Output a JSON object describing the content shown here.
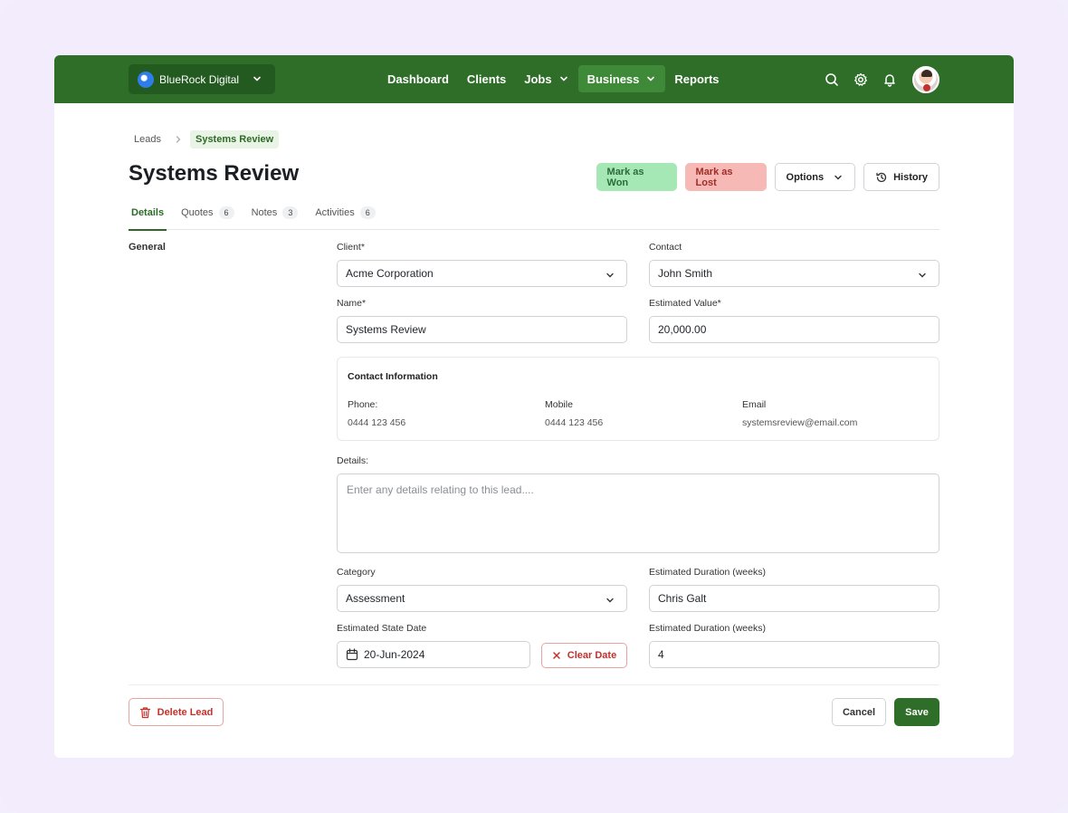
{
  "app": {
    "org_name": "BlueRock Digital",
    "nav": [
      {
        "label": "Dashboard"
      },
      {
        "label": "Clients"
      },
      {
        "label": "Jobs"
      },
      {
        "label": "Business"
      },
      {
        "label": "Reports"
      }
    ]
  },
  "breadcrumb": {
    "parent": "Leads",
    "current": "Systems Review"
  },
  "page": {
    "title": "Systems Review",
    "actions": {
      "won": "Mark as Won",
      "lost": "Mark as Lost",
      "options": "Options",
      "history": "History"
    }
  },
  "tabs": [
    {
      "label": "Details",
      "count": ""
    },
    {
      "label": "Quotes",
      "count": "6"
    },
    {
      "label": "Notes",
      "count": "3"
    },
    {
      "label": "Activities",
      "count": "6"
    }
  ],
  "form": {
    "section": "General",
    "client_label": "Client*",
    "client_value": "Acme Corporation",
    "contact_label": "Contact",
    "contact_value": "John Smith",
    "name_label": "Name*",
    "name_value": "Systems Review",
    "value_label": "Estimated Value*",
    "value_value": "20,000.00",
    "contact_info": {
      "title": "Contact Information",
      "phone_label": "Phone:",
      "phone_value": "0444 123 456",
      "mobile_label": "Mobile",
      "mobile_value": "0444 123 456",
      "email_label": "Email",
      "email_value": "systemsreview@email.com"
    },
    "details_label": "Details:",
    "details_placeholder": "Enter any details relating to this lead....",
    "category_label": "Category",
    "category_value": "Assessment",
    "duration_label_1": "Estimated Duration (weeks)",
    "duration_value_1": "Chris Galt",
    "start_date_label": "Estimated State Date",
    "start_date_value": "20-Jun-2024",
    "clear_date": "Clear Date",
    "duration_label_2": "Estimated Duration (weeks)",
    "duration_value_2": "4"
  },
  "footer": {
    "delete": "Delete Lead",
    "cancel": "Cancel",
    "save": "Save"
  },
  "colors": {
    "brand_green": "#2e6e28",
    "won_bg": "#a5e8b5",
    "lost_bg": "#f7b9b6",
    "danger": "#c5302a"
  }
}
